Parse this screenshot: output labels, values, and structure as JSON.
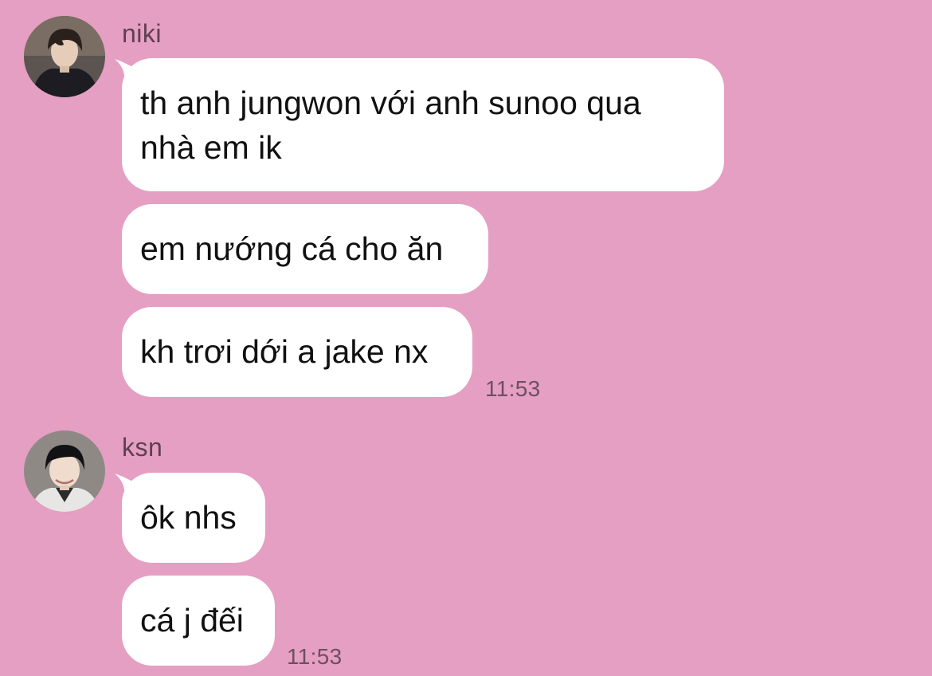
{
  "background_color": "#e59fc2",
  "bubble_color": "#ffffff",
  "groups": [
    {
      "sender": "niki",
      "avatar": "profile-photo",
      "messages": [
        "th anh jungwon với anh sunoo qua\nnhà em ik",
        "em nướng cá cho ăn",
        "kh trơi dới a jake nx"
      ],
      "time": "11:53"
    },
    {
      "sender": "ksn",
      "avatar": "profile-photo",
      "messages": [
        "ôk nhs",
        "cá j đếi"
      ],
      "time": "11:53"
    }
  ]
}
